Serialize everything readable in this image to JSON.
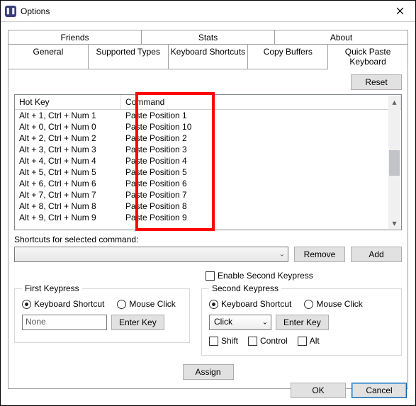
{
  "window": {
    "title": "Options"
  },
  "tabs_top": [
    "Friends",
    "Stats",
    "About"
  ],
  "tabs_bottom": [
    "General",
    "Supported Types",
    "Keyboard Shortcuts",
    "Copy Buffers",
    "Quick Paste Keyboard"
  ],
  "active_tab": "Quick Paste Keyboard",
  "reset_label": "Reset",
  "table": {
    "headers": {
      "hotkey": "Hot Key",
      "command": "Command"
    },
    "rows": [
      {
        "hotkey": "Alt + 1, Ctrl + Num 1",
        "command": "Paste Position 1"
      },
      {
        "hotkey": "Alt + 0, Ctrl + Num 0",
        "command": "Paste Position 10"
      },
      {
        "hotkey": "Alt + 2, Ctrl + Num 2",
        "command": "Paste Position 2"
      },
      {
        "hotkey": "Alt + 3, Ctrl + Num 3",
        "command": "Paste Position 3"
      },
      {
        "hotkey": "Alt + 4, Ctrl + Num 4",
        "command": "Paste Position 4"
      },
      {
        "hotkey": "Alt + 5, Ctrl + Num 5",
        "command": "Paste Position 5"
      },
      {
        "hotkey": "Alt + 6, Ctrl + Num 6",
        "command": "Paste Position 6"
      },
      {
        "hotkey": "Alt + 7, Ctrl + Num 7",
        "command": "Paste Position 7"
      },
      {
        "hotkey": "Alt + 8, Ctrl + Num 8",
        "command": "Paste Position 8"
      },
      {
        "hotkey": "Alt + 9, Ctrl + Num 9",
        "command": "Paste Position 9"
      }
    ]
  },
  "shortcuts_label": "Shortcuts for selected command:",
  "remove_label": "Remove",
  "add_label": "Add",
  "enable_second": "Enable Second Keypress",
  "first_group": {
    "legend": "First Keypress",
    "radio_shortcut": "Keyboard Shortcut",
    "radio_mouse": "Mouse Click",
    "input_value": "None",
    "enter_key": "Enter Key"
  },
  "second_group": {
    "legend": "Second Keypress",
    "radio_shortcut": "Keyboard Shortcut",
    "radio_mouse": "Mouse Click",
    "click_value": "Click",
    "enter_key": "Enter Key",
    "shift": "Shift",
    "control": "Control",
    "alt": "Alt"
  },
  "assign_label": "Assign",
  "ok_label": "OK",
  "cancel_label": "Cancel"
}
